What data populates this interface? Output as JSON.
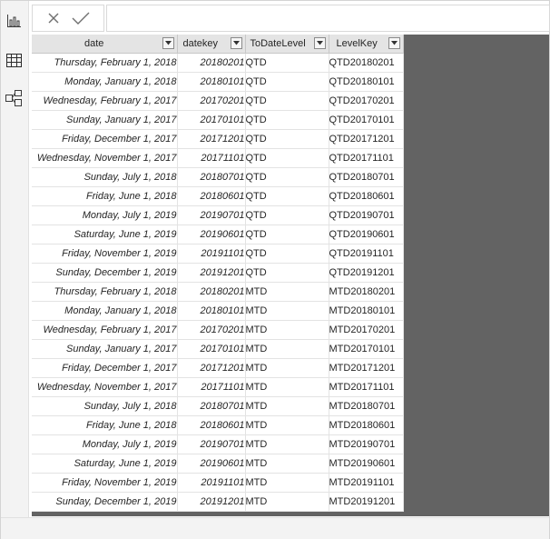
{
  "icons": {
    "report_view": "bar-chart-icon",
    "data_view": "table-icon",
    "model_view": "model-icon",
    "cancel": "close-icon",
    "commit": "checkmark-icon",
    "column_filter": "chevron-down-icon"
  },
  "colors": {
    "grid_background": "#636363",
    "header_background": "#e4e4e4",
    "rail_background": "#f3f3f3"
  },
  "formula_bar": {
    "value": ""
  },
  "table": {
    "columns": [
      "date",
      "datekey",
      "ToDateLevel",
      "LevelKey"
    ],
    "rows": [
      [
        "Thursday, February 1, 2018",
        "20180201",
        "QTD",
        "QTD20180201"
      ],
      [
        "Monday, January 1, 2018",
        "20180101",
        "QTD",
        "QTD20180101"
      ],
      [
        "Wednesday, February 1, 2017",
        "20170201",
        "QTD",
        "QTD20170201"
      ],
      [
        "Sunday, January 1, 2017",
        "20170101",
        "QTD",
        "QTD20170101"
      ],
      [
        "Friday, December 1, 2017",
        "20171201",
        "QTD",
        "QTD20171201"
      ],
      [
        "Wednesday, November 1, 2017",
        "20171101",
        "QTD",
        "QTD20171101"
      ],
      [
        "Sunday, July 1, 2018",
        "20180701",
        "QTD",
        "QTD20180701"
      ],
      [
        "Friday, June 1, 2018",
        "20180601",
        "QTD",
        "QTD20180601"
      ],
      [
        "Monday, July 1, 2019",
        "20190701",
        "QTD",
        "QTD20190701"
      ],
      [
        "Saturday, June 1, 2019",
        "20190601",
        "QTD",
        "QTD20190601"
      ],
      [
        "Friday, November 1, 2019",
        "20191101",
        "QTD",
        "QTD20191101"
      ],
      [
        "Sunday, December 1, 2019",
        "20191201",
        "QTD",
        "QTD20191201"
      ],
      [
        "Thursday, February 1, 2018",
        "20180201",
        "MTD",
        "MTD20180201"
      ],
      [
        "Monday, January 1, 2018",
        "20180101",
        "MTD",
        "MTD20180101"
      ],
      [
        "Wednesday, February 1, 2017",
        "20170201",
        "MTD",
        "MTD20170201"
      ],
      [
        "Sunday, January 1, 2017",
        "20170101",
        "MTD",
        "MTD20170101"
      ],
      [
        "Friday, December 1, 2017",
        "20171201",
        "MTD",
        "MTD20171201"
      ],
      [
        "Wednesday, November 1, 2017",
        "20171101",
        "MTD",
        "MTD20171101"
      ],
      [
        "Sunday, July 1, 2018",
        "20180701",
        "MTD",
        "MTD20180701"
      ],
      [
        "Friday, June 1, 2018",
        "20180601",
        "MTD",
        "MTD20180601"
      ],
      [
        "Monday, July 1, 2019",
        "20190701",
        "MTD",
        "MTD20190701"
      ],
      [
        "Saturday, June 1, 2019",
        "20190601",
        "MTD",
        "MTD20190601"
      ],
      [
        "Friday, November 1, 2019",
        "20191101",
        "MTD",
        "MTD20191101"
      ],
      [
        "Sunday, December 1, 2019",
        "20191201",
        "MTD",
        "MTD20191201"
      ]
    ]
  }
}
